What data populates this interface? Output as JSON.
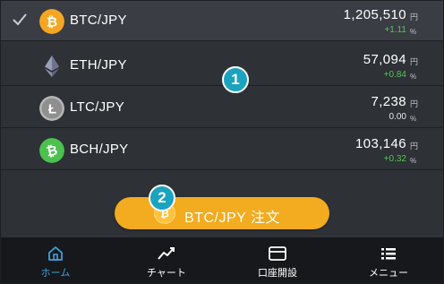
{
  "markets": [
    {
      "pair": "BTC/JPY",
      "price": "1,205,510",
      "unit": "円",
      "change": "+1.11",
      "pct": "%",
      "coin_icon": "bitcoin-icon",
      "coin_color": "#f5a623",
      "trend": "up",
      "selected": true
    },
    {
      "pair": "ETH/JPY",
      "price": "57,094",
      "unit": "円",
      "change": "+0.84",
      "pct": "%",
      "coin_icon": "ethereum-icon",
      "coin_color": "#8a8fa8",
      "trend": "up",
      "selected": false
    },
    {
      "pair": "LTC/JPY",
      "price": "7,238",
      "unit": "円",
      "change": "0.00",
      "pct": "%",
      "coin_icon": "litecoin-icon",
      "coin_color": "#b8b8b8",
      "trend": "flat",
      "selected": false
    },
    {
      "pair": "BCH/JPY",
      "price": "103,146",
      "unit": "円",
      "change": "+0.32",
      "pct": "%",
      "coin_icon": "bitcoin-cash-icon",
      "coin_color": "#4cc14f",
      "trend": "up",
      "selected": false
    }
  ],
  "callouts": {
    "one": "1",
    "two": "2"
  },
  "order_button": {
    "label": "BTC/JPY 注文",
    "icon": "bitcoin-icon"
  },
  "tabs": [
    {
      "label": "ホーム",
      "icon": "home-icon",
      "active": true
    },
    {
      "label": "チャート",
      "icon": "chart-line-icon",
      "active": false
    },
    {
      "label": "口座開設",
      "icon": "card-icon",
      "active": false
    },
    {
      "label": "メニュー",
      "icon": "menu-list-icon",
      "active": false
    }
  ],
  "colors": {
    "background": "#2e3136",
    "selected_row": "#3a3d43",
    "positive": "#52c55a",
    "order_button": "#f3ab1f",
    "active_tab": "#3ea3e0",
    "callout": "#1aa3bf",
    "tabbar": "#17181b"
  }
}
